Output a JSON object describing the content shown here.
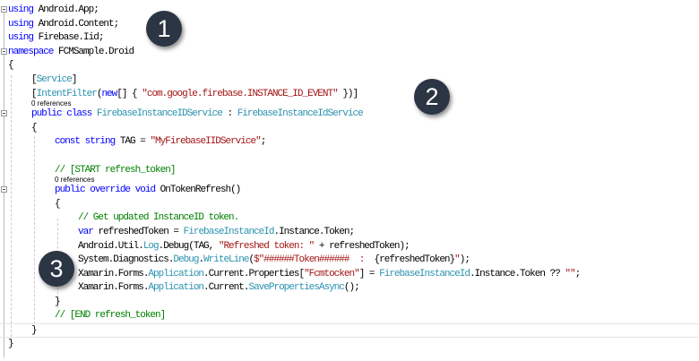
{
  "colors": {
    "keyword": "#0000ff",
    "type": "#2b91af",
    "string": "#a31515",
    "comment": "#008000",
    "badge": "#2b3544"
  },
  "badges": [
    "1",
    "2",
    "3"
  ],
  "lines": [
    {
      "indent": 0,
      "fold": true,
      "seg": [
        [
          "using",
          "kw"
        ],
        [
          " Android.App;",
          "pl"
        ]
      ]
    },
    {
      "indent": 0,
      "seg": [
        [
          "using",
          "kw"
        ],
        [
          " Android.Content;",
          "pl"
        ]
      ]
    },
    {
      "indent": 0,
      "seg": [
        [
          "using",
          "kw"
        ],
        [
          " Firebase.Iid;",
          "pl"
        ]
      ]
    },
    {
      "indent": 0,
      "fold": true,
      "seg": [
        [
          "namespace",
          "kw"
        ],
        [
          " FCMSample.Droid",
          "pl"
        ]
      ]
    },
    {
      "indent": 0,
      "seg": [
        [
          "{",
          "pl"
        ]
      ]
    },
    {
      "indent": 1,
      "seg": [
        [
          "[",
          "pl"
        ],
        [
          "Service",
          "ty"
        ],
        [
          "]",
          "pl"
        ]
      ]
    },
    {
      "indent": 1,
      "seg": [
        [
          "[",
          "pl"
        ],
        [
          "IntentFilter",
          "ty"
        ],
        [
          "(",
          "pl"
        ],
        [
          "new",
          "kw"
        ],
        [
          "[] { ",
          "pl"
        ],
        [
          "\"com.google.firebase.INSTANCE_ID_EVENT\"",
          "str"
        ],
        [
          " })]",
          "pl"
        ]
      ]
    },
    {
      "indent": 1,
      "ref": true,
      "seg": [
        [
          "0 references",
          "pl"
        ]
      ]
    },
    {
      "indent": 1,
      "fold": true,
      "seg": [
        [
          "public",
          "kw"
        ],
        [
          " ",
          "pl"
        ],
        [
          "class",
          "kw"
        ],
        [
          " ",
          "pl"
        ],
        [
          "FirebaseInstanceIDService",
          "ty"
        ],
        [
          " : ",
          "pl"
        ],
        [
          "FirebaseInstanceIdService",
          "ty"
        ]
      ]
    },
    {
      "indent": 1,
      "seg": [
        [
          "{",
          "pl"
        ]
      ]
    },
    {
      "indent": 2,
      "seg": [
        [
          "const",
          "kw"
        ],
        [
          " ",
          "pl"
        ],
        [
          "string",
          "kw"
        ],
        [
          " TAG = ",
          "pl"
        ],
        [
          "\"MyFirebaseIIDService\"",
          "str"
        ],
        [
          ";",
          "pl"
        ]
      ]
    },
    {
      "indent": 2,
      "seg": [
        [
          "",
          "pl"
        ]
      ]
    },
    {
      "indent": 2,
      "seg": [
        [
          "// [START refresh_token]",
          "cm"
        ]
      ]
    },
    {
      "indent": 2,
      "ref": true,
      "seg": [
        [
          "0 references",
          "pl"
        ]
      ]
    },
    {
      "indent": 2,
      "fold": true,
      "seg": [
        [
          "public",
          "kw"
        ],
        [
          " ",
          "pl"
        ],
        [
          "override",
          "kw"
        ],
        [
          " ",
          "pl"
        ],
        [
          "void",
          "kw"
        ],
        [
          " OnTokenRefresh()",
          "pl"
        ]
      ]
    },
    {
      "indent": 2,
      "seg": [
        [
          "{",
          "pl"
        ]
      ]
    },
    {
      "indent": 3,
      "seg": [
        [
          "// Get updated InstanceID token.",
          "cm"
        ]
      ]
    },
    {
      "indent": 3,
      "seg": [
        [
          "var",
          "kw"
        ],
        [
          " refreshedToken = ",
          "pl"
        ],
        [
          "FirebaseInstanceId",
          "ty"
        ],
        [
          ".Instance.Token;",
          "pl"
        ]
      ]
    },
    {
      "indent": 3,
      "seg": [
        [
          "Android.Util.",
          "pl"
        ],
        [
          "Log",
          "ty"
        ],
        [
          ".Debug(TAG, ",
          "pl"
        ],
        [
          "\"Refreshed token: \"",
          "str"
        ],
        [
          " + refreshedToken);",
          "pl"
        ]
      ]
    },
    {
      "indent": 3,
      "seg": [
        [
          "System.Diagnostics.",
          "pl"
        ],
        [
          "Debug",
          "ty"
        ],
        [
          ".",
          "pl"
        ],
        [
          "WriteLine",
          "ty"
        ],
        [
          "(",
          "pl"
        ],
        [
          "$\"######Token######  :  ",
          "str"
        ],
        [
          "{refreshedToken}",
          "pl"
        ],
        [
          "\"",
          "str"
        ],
        [
          ");",
          "pl"
        ]
      ]
    },
    {
      "indent": 3,
      "seg": [
        [
          "Xamarin.Forms.",
          "pl"
        ],
        [
          "Application",
          "ty"
        ],
        [
          ".Current.Properties[",
          "pl"
        ],
        [
          "\"Fcmtocken\"",
          "str"
        ],
        [
          "] = ",
          "pl"
        ],
        [
          "FirebaseInstanceId",
          "ty"
        ],
        [
          ".Instance.Token ?? ",
          "pl"
        ],
        [
          "\"\"",
          "str"
        ],
        [
          ";",
          "pl"
        ]
      ]
    },
    {
      "indent": 3,
      "seg": [
        [
          "Xamarin.Forms.",
          "pl"
        ],
        [
          "Application",
          "ty"
        ],
        [
          ".Current.",
          "pl"
        ],
        [
          "SavePropertiesAsync",
          "ty"
        ],
        [
          "();",
          "pl"
        ]
      ]
    },
    {
      "indent": 2,
      "seg": [
        [
          "}",
          "pl"
        ]
      ]
    },
    {
      "indent": 2,
      "seg": [
        [
          "// [END refresh_token]",
          "cm"
        ]
      ]
    },
    {
      "indent": 1,
      "current": true,
      "seg": [
        [
          "}",
          "pl"
        ]
      ]
    },
    {
      "indent": 0,
      "seg": [
        [
          "}",
          "pl"
        ]
      ]
    }
  ]
}
